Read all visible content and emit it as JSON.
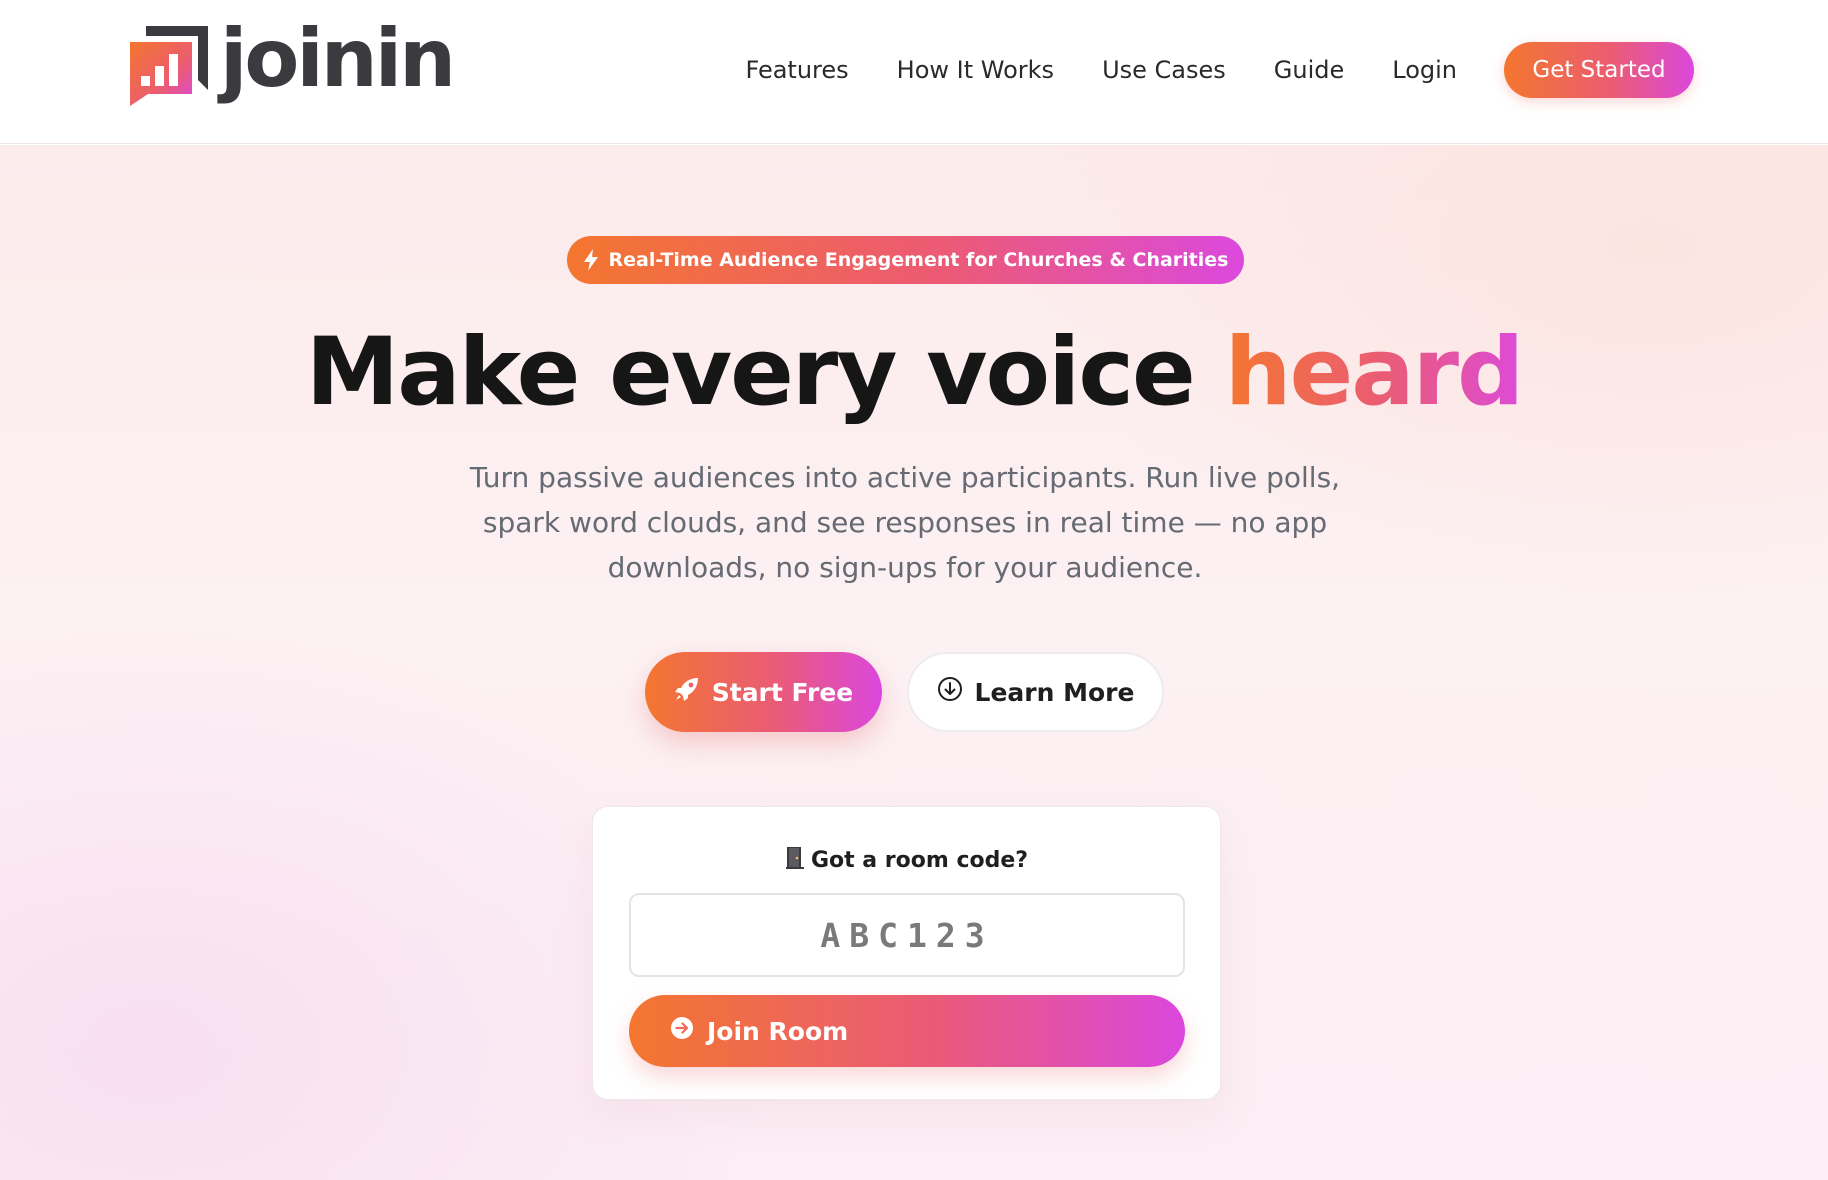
{
  "brand": {
    "name": "joinin",
    "logo_icon": "bar-chart-speech-bubble-icon"
  },
  "nav": {
    "links": [
      "Features",
      "How It Works",
      "Use Cases",
      "Guide",
      "Login"
    ],
    "cta_label": "Get Started"
  },
  "hero": {
    "badge_text": "Real-Time Audience Engagement for Churches & Charities",
    "badge_icon": "lightning-bolt-icon",
    "headline_main": "Make every voice",
    "headline_accent": "heard",
    "subtitle": "Turn passive audiences into active participants. Run live polls, spark word clouds, and see responses in real time — no app downloads, no sign-ups for your audience.",
    "primary_cta": "Start Free",
    "primary_cta_icon": "rocket-icon",
    "secondary_cta": "Learn More",
    "secondary_cta_icon": "arrow-down-circle-icon"
  },
  "room": {
    "label": "Got a room code?",
    "label_icon": "door-icon",
    "placeholder": "ABC123",
    "join_label": "Join Room",
    "join_icon": "arrow-right-circle-icon"
  },
  "colors": {
    "gradient_start": "#f4762f",
    "gradient_mid": "#eb5d6f",
    "gradient_end": "#db47dd",
    "text_dark": "#161616",
    "text_muted": "#666a73"
  }
}
